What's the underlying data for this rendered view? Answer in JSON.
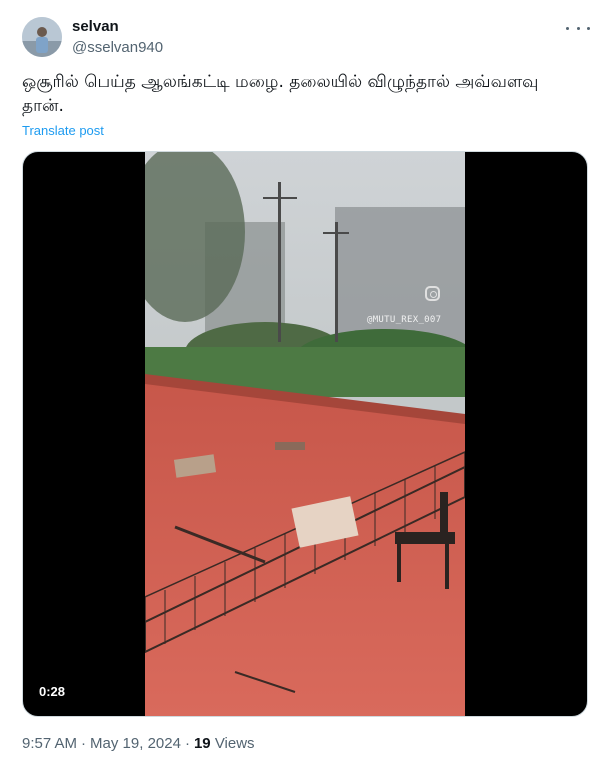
{
  "author": {
    "display_name": "selvan",
    "handle": "@sselvan940"
  },
  "post": {
    "text": "ஒசூரில் பெய்த ஆலங்கட்டி மழை. தலையில் விழுந்தால் அவ்வளவு தான்.",
    "translate_label": "Translate post"
  },
  "video": {
    "duration": "0:28",
    "watermark": "@MUTU_REX_007"
  },
  "meta": {
    "time": "9:57 AM",
    "separator": "·",
    "date": "May 19, 2024",
    "views_count": "19",
    "views_label": "Views"
  },
  "icons": {
    "more": "more-horizontal-icon",
    "instagram": "instagram-icon"
  },
  "colors": {
    "link": "#1d9bf0",
    "secondary_text": "#536471",
    "roof": "#d14a3a"
  }
}
